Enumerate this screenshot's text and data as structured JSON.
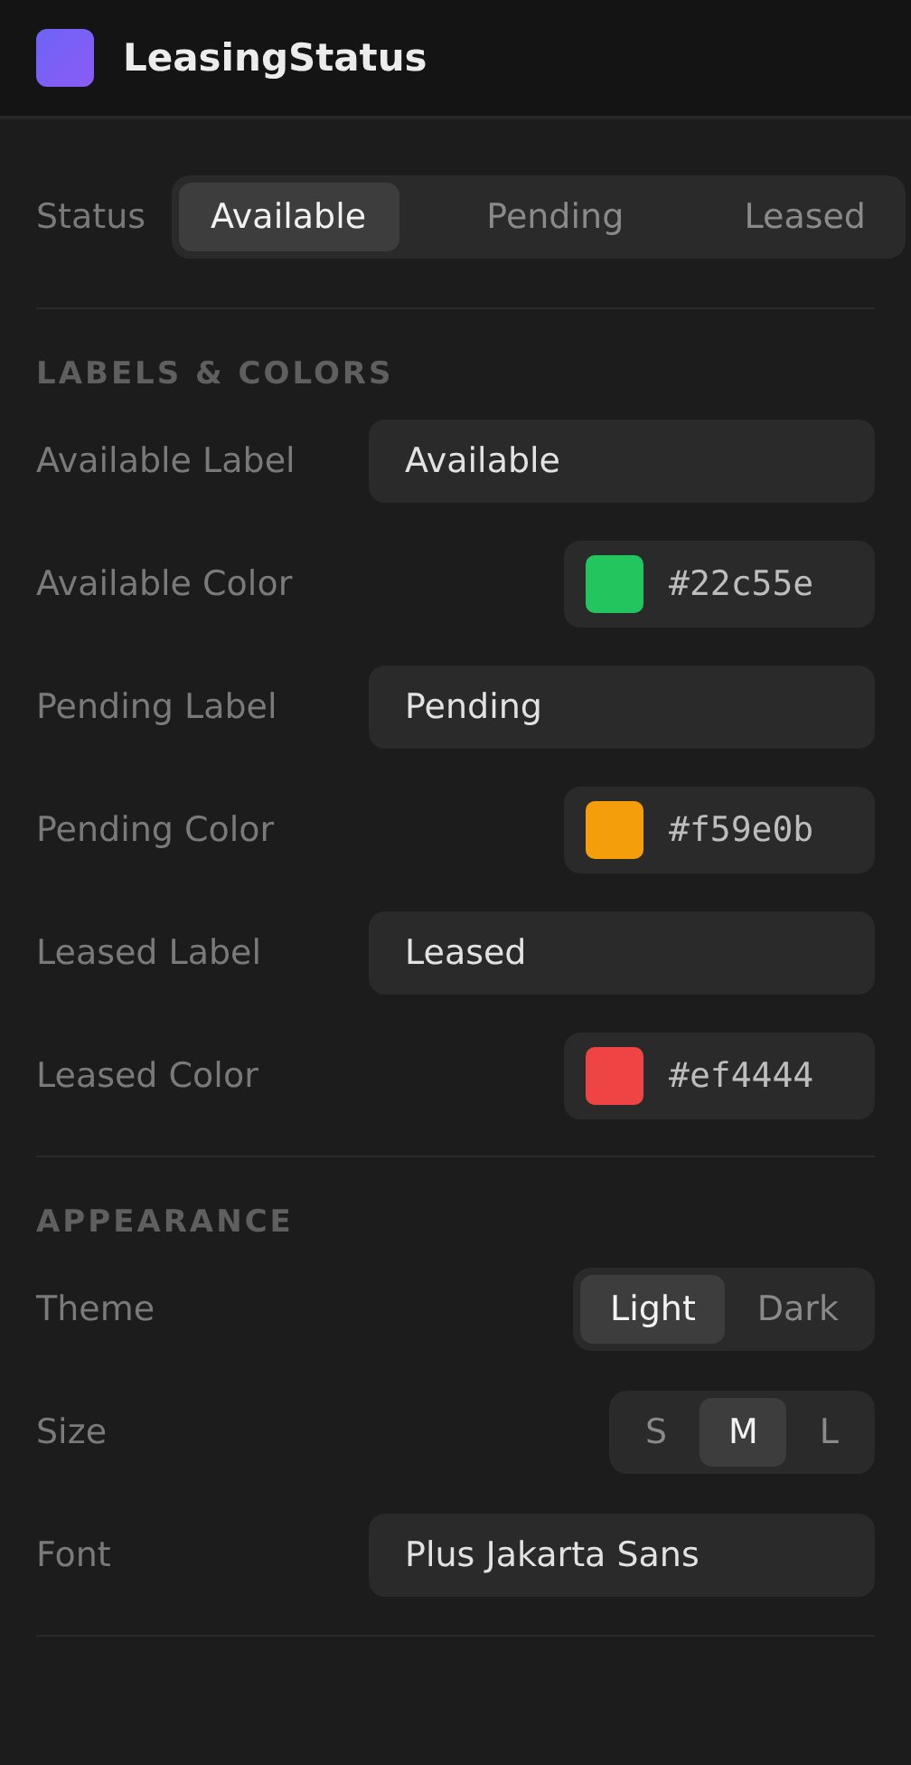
{
  "header": {
    "title": "LeasingStatus"
  },
  "status": {
    "label": "Status",
    "options": [
      {
        "label": "Available",
        "selected": true
      },
      {
        "label": "Pending",
        "selected": false
      },
      {
        "label": "Leased",
        "selected": false
      }
    ]
  },
  "sections": [
    {
      "title": "LABELS & COLORS",
      "rows": [
        {
          "kind": "text",
          "label": "Available Label",
          "value": "Available"
        },
        {
          "kind": "color",
          "label": "Available Color",
          "value": "#22c55e",
          "color": "#22c55e"
        },
        {
          "kind": "text",
          "label": "Pending Label",
          "value": "Pending"
        },
        {
          "kind": "color",
          "label": "Pending Color",
          "value": "#f59e0b",
          "color": "#f59e0b"
        },
        {
          "kind": "text",
          "label": "Leased Label",
          "value": "Leased"
        },
        {
          "kind": "color",
          "label": "Leased Color",
          "value": "#ef4444",
          "color": "#ef4444"
        }
      ]
    },
    {
      "title": "APPEARANCE",
      "rows": [
        {
          "kind": "segmented",
          "label": "Theme",
          "options": [
            {
              "label": "Light",
              "selected": true
            },
            {
              "label": "Dark",
              "selected": false
            }
          ]
        },
        {
          "kind": "segmented",
          "label": "Size",
          "options": [
            {
              "label": "S",
              "selected": false
            },
            {
              "label": "M",
              "selected": true
            },
            {
              "label": "L",
              "selected": false
            }
          ]
        },
        {
          "kind": "text",
          "label": "Font",
          "value": "Plus Jakarta Sans"
        }
      ]
    }
  ]
}
